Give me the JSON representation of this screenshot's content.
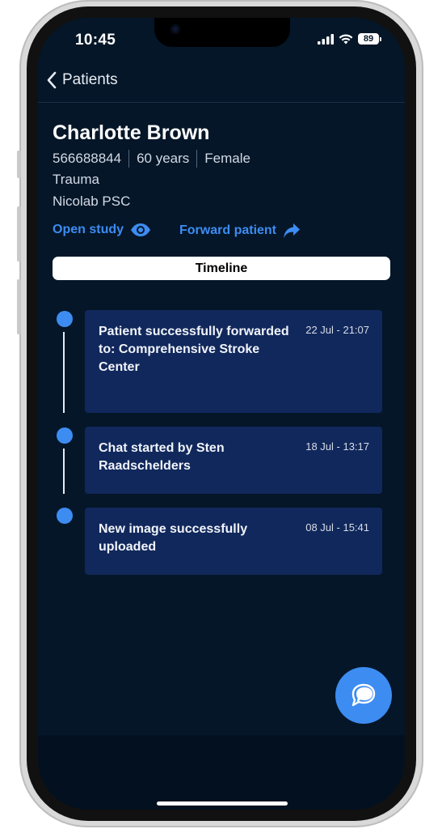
{
  "status_bar": {
    "time": "10:45",
    "battery": "89"
  },
  "nav": {
    "back_label": "Patients"
  },
  "patient": {
    "name": "Charlotte Brown",
    "id": "566688844",
    "age": "60 years",
    "sex": "Female",
    "category": "Trauma",
    "hospital": "Nicolab PSC"
  },
  "actions": {
    "open_study": "Open study",
    "forward_patient": "Forward patient"
  },
  "tabs": {
    "timeline": "Timeline"
  },
  "timeline": [
    {
      "text": "Patient successfully forwarded to: Comprehensive Stroke Center",
      "time": "22 Jul - 21:07"
    },
    {
      "text": "Chat started by Sten Raadschelders",
      "time": "18 Jul - 13:17"
    },
    {
      "text": "New image successfully uploaded",
      "time": "08 Jul - 15:41"
    }
  ],
  "colors": {
    "background": "#041628",
    "card": "#11285c",
    "accent": "#3d8cf2"
  },
  "icons": {
    "back": "chevron-left-icon",
    "open_study": "eye-icon",
    "forward": "share-arrow-icon",
    "chat": "chat-bubbles-icon"
  }
}
